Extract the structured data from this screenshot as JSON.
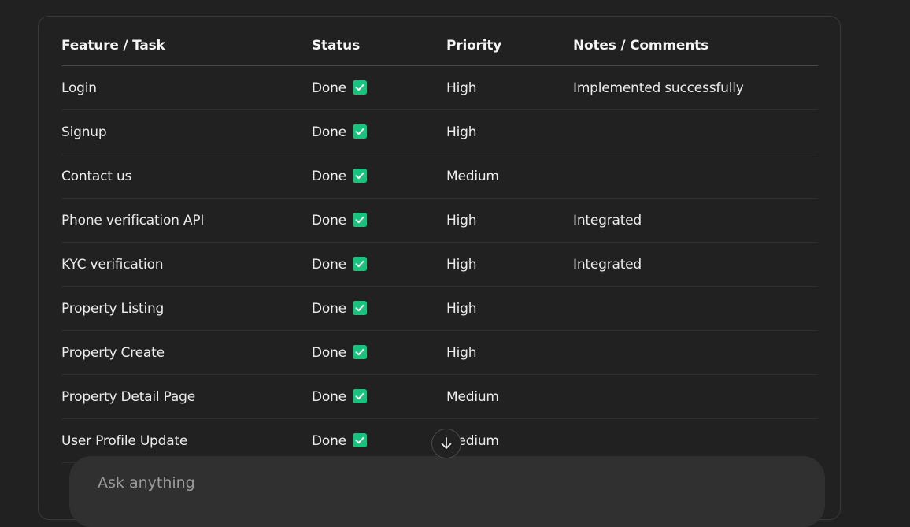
{
  "table": {
    "headers": [
      "Feature / Task",
      "Status",
      "Priority",
      "Notes / Comments"
    ],
    "rows": [
      {
        "feature": "Login",
        "status": "Done",
        "priority": "High",
        "notes": "Implemented successfully"
      },
      {
        "feature": "Signup",
        "status": "Done",
        "priority": "High",
        "notes": ""
      },
      {
        "feature": "Contact us",
        "status": "Done",
        "priority": "Medium",
        "notes": ""
      },
      {
        "feature": "Phone verification API",
        "status": "Done",
        "priority": "High",
        "notes": "Integrated"
      },
      {
        "feature": "KYC verification",
        "status": "Done",
        "priority": "High",
        "notes": "Integrated"
      },
      {
        "feature": "Property Listing",
        "status": "Done",
        "priority": "High",
        "notes": ""
      },
      {
        "feature": "Property Create",
        "status": "Done",
        "priority": "High",
        "notes": ""
      },
      {
        "feature": "Property Detail Page",
        "status": "Done",
        "priority": "Medium",
        "notes": ""
      },
      {
        "feature": "User Profile Update",
        "status": "Done",
        "priority": "Medium",
        "notes": ""
      }
    ],
    "status_icon": "check-mark-icon"
  },
  "composer": {
    "placeholder": "Ask anything"
  },
  "scroll_button": {
    "icon": "arrow-down-icon"
  },
  "colors": {
    "background": "#212121",
    "check_green": "#19c37d",
    "composer_bg": "#303030"
  }
}
